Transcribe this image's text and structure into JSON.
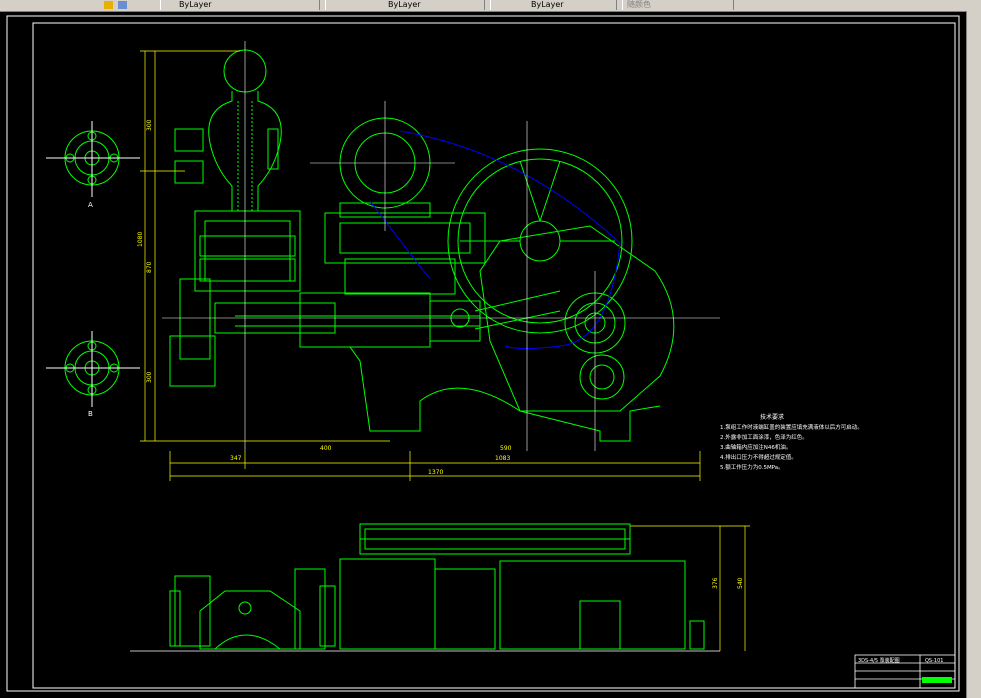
{
  "toolbar": {
    "layer_1": "ByLayer",
    "layer_2": "ByLayer",
    "layer_3": "ByLayer",
    "plot_style": "随颜色"
  },
  "views": {
    "view_a_label": "A",
    "view_b_label": "B"
  },
  "dimensions": {
    "d_top_vertical": "300",
    "d_mid_vertical": "870",
    "d_total_vertical": "1080",
    "d_bottom_vertical": "300",
    "d_347": "347",
    "d_400": "400",
    "d_590": "590",
    "d_1083": "1083",
    "d_1370": "1370",
    "d_side_inner": "376",
    "d_side_outer": "540"
  },
  "notes": {
    "title": "技术要求",
    "lines": [
      "1.泵组工作时液端缸盖的装置应填充满液体以后方可启动。",
      "2.外露非加工面涂漆，色泽为红色。",
      "3.曲轴箱内应加注N46机油。",
      "4.排出口压力不得超过规定值。",
      "5.额工作压力为0.5MPa。"
    ]
  },
  "title_block": {
    "drawing_name": "3DS-4/5 泵装配图",
    "drawing_code": "QS-101"
  },
  "colors": {
    "background": "#000000",
    "line": "#00ff00",
    "dimension": "#ffff00",
    "belt": "#0000ff",
    "text": "#ffffff"
  }
}
